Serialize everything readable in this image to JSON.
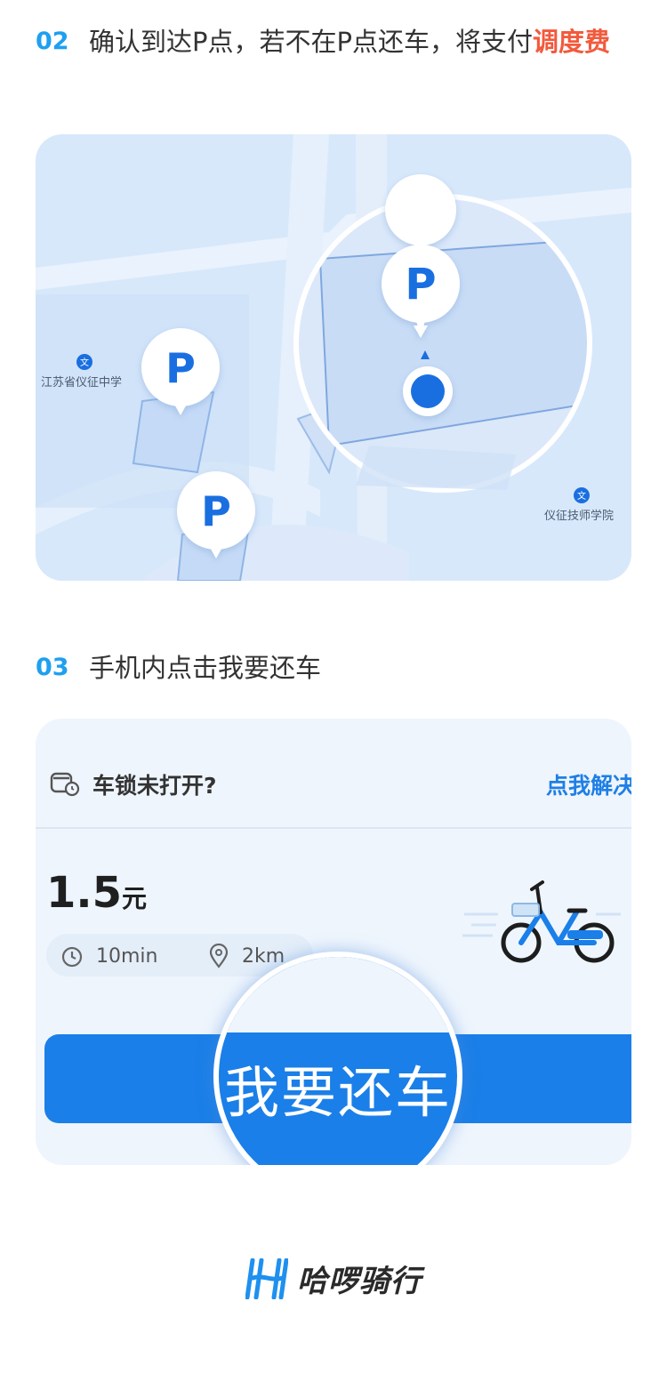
{
  "step2": {
    "number": "02",
    "text": "确认到达P点，若不在P点还车，将支付",
    "highlight": "调度费"
  },
  "map": {
    "p_marker": "P",
    "poi_1": "江苏省仪征中学",
    "poi_2": "仪征技师学院",
    "poi_icon": "文"
  },
  "step3": {
    "number": "03",
    "text": "手机内点击我要还车"
  },
  "app": {
    "lock_text": "车锁未打开?",
    "fix_link": "点我解决",
    "price_value": "1.5",
    "price_unit": "元",
    "duration": "10min",
    "distance": "2km",
    "return_button": "我要还车"
  },
  "brand": {
    "name": "哈啰骑行"
  },
  "colors": {
    "step_number": "#1ea0f0",
    "highlight": "#f25a3c",
    "primary_blue": "#1a7fe8",
    "link_blue": "#1e7fe6"
  }
}
